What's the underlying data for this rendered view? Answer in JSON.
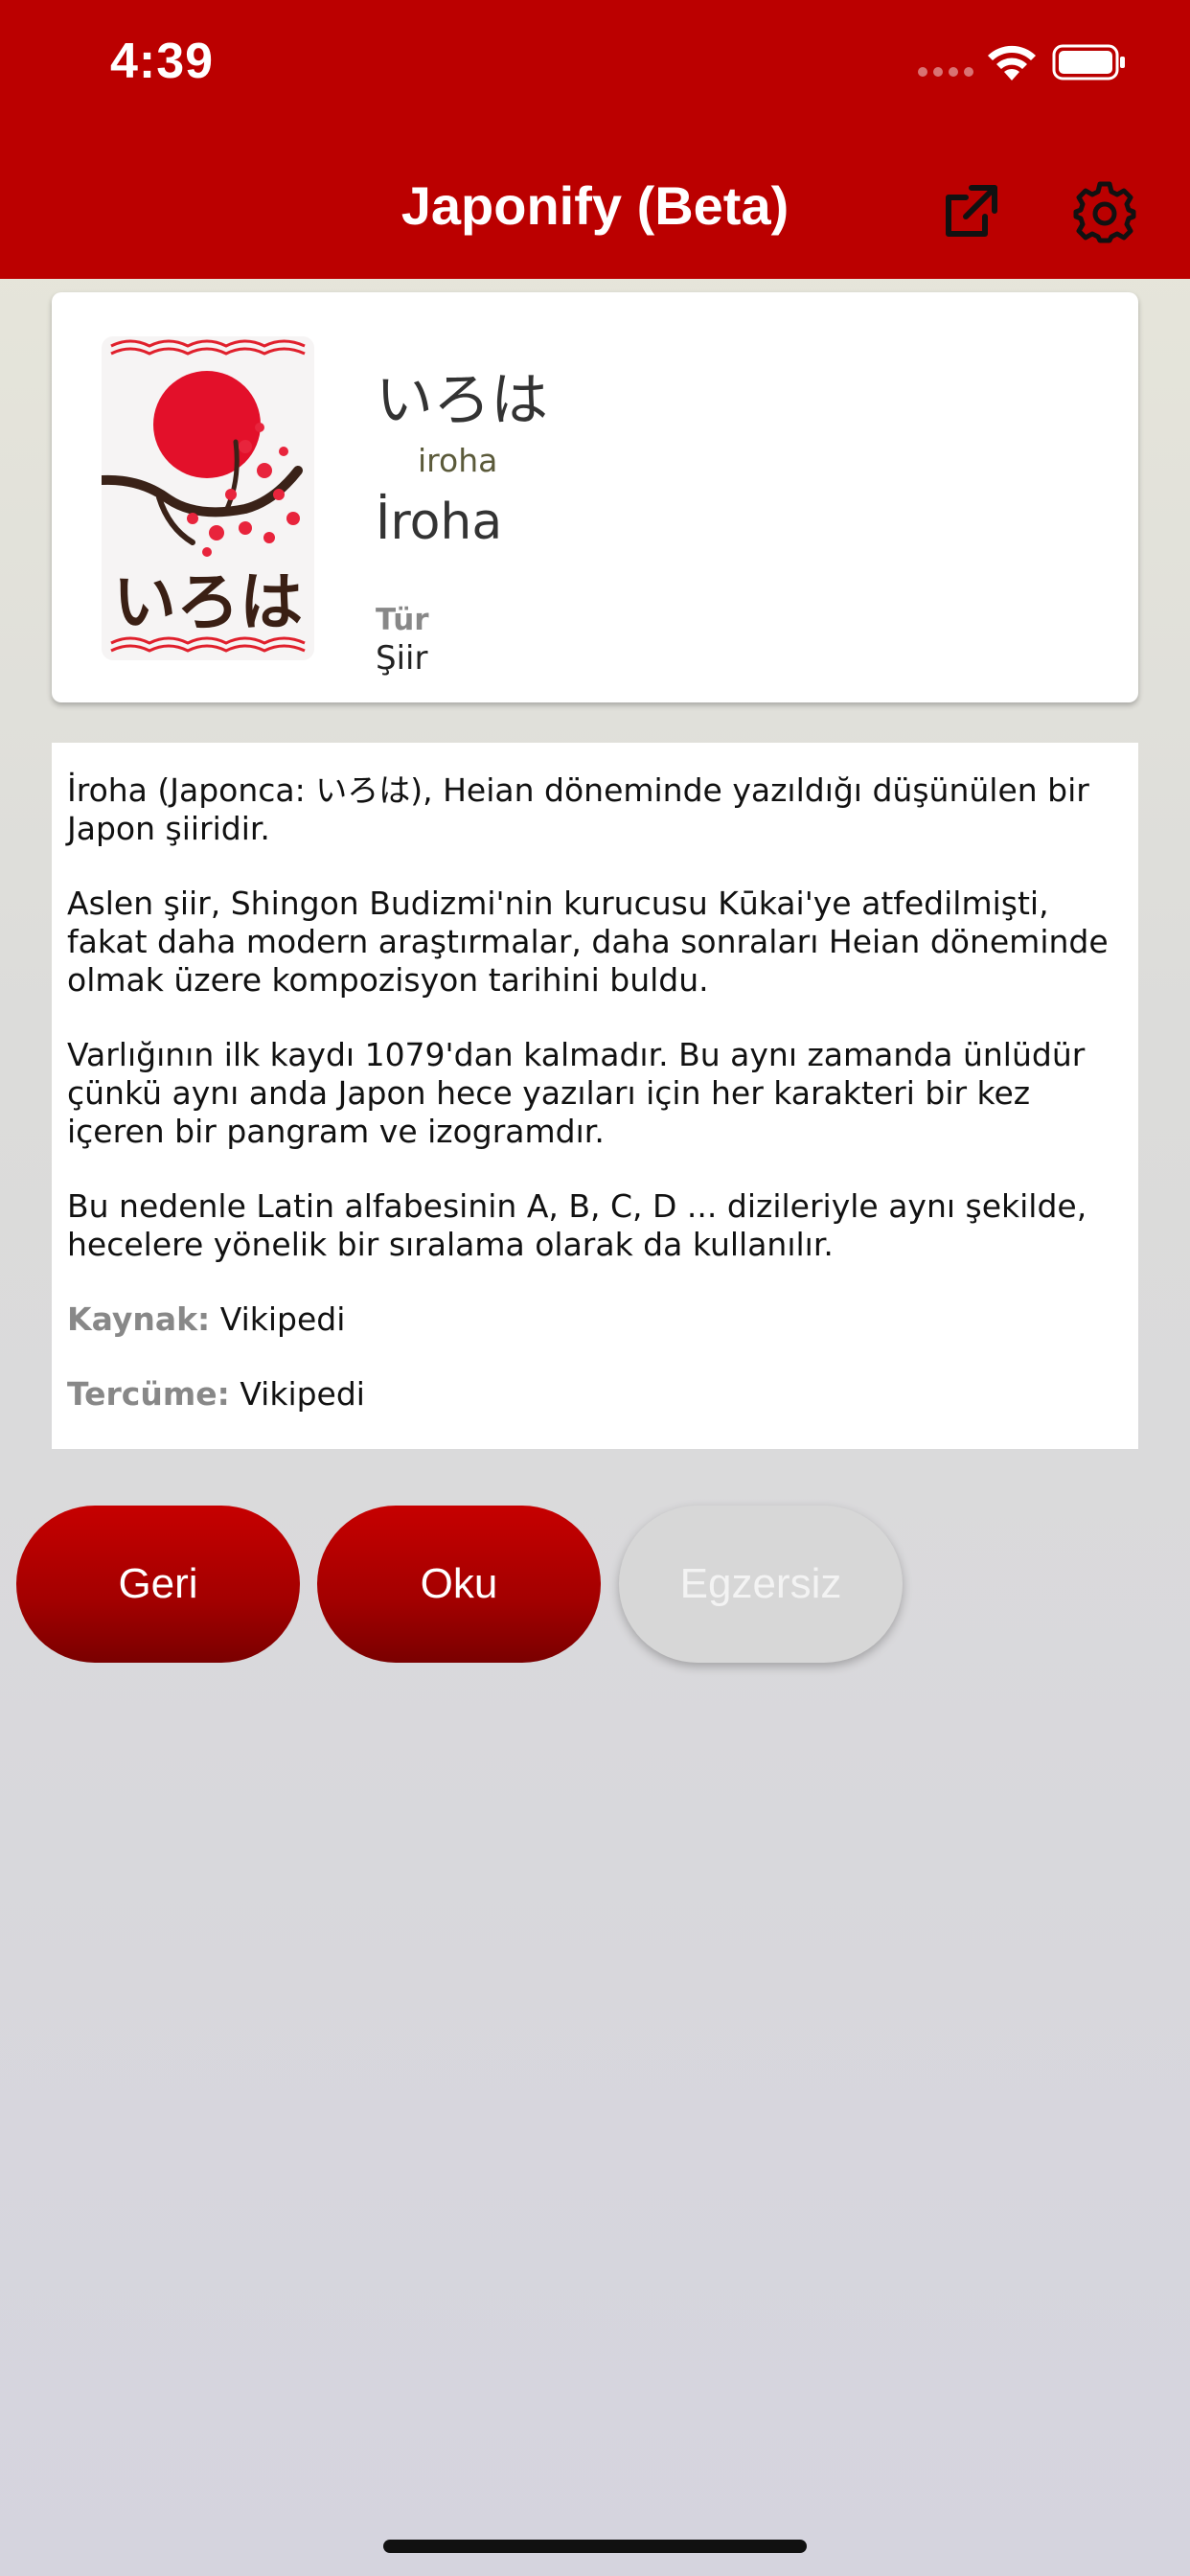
{
  "status_bar": {
    "time": "4:39"
  },
  "header": {
    "title": "Japonify (Beta)",
    "share_icon": "external-link-icon",
    "settings_icon": "gear-icon",
    "color": "#bb0000"
  },
  "info": {
    "japanese_title": "いろは",
    "romaji": "iroha",
    "turkish_title": "İroha",
    "genre_label": "Tür",
    "genre_value": "Şiir",
    "poster_text": "いろは"
  },
  "description": {
    "paragraphs": [
      "İroha (Japonca: いろは), Heian döneminde yazıldığı düşünülen bir Japon şiiridir.",
      "Aslen şiir, Shingon Budizmi'nin kurucusu Kūkai'ye atfedilmişti, fakat daha modern araştırmalar, daha sonraları Heian döneminde olmak üzere kompozisyon tarihini buldu.",
      "Varlığının ilk kaydı 1079'dan kalmadır. Bu aynı zamanda ünlüdür çünkü aynı anda Japon hece yazıları için her karakteri bir kez içeren bir pangram ve izogramdır.",
      "Bu nedenle Latin alfabesinin A, B, C, D ... dizileriyle aynı şekilde, hecelere yönelik bir sıralama olarak da kullanılır."
    ],
    "source_label": "Kaynak:",
    "source_value": "Vikipedi",
    "translation_label": "Tercüme:",
    "translation_value": "Vikipedi"
  },
  "buttons": {
    "back": "Geri",
    "read": "Oku",
    "exercise": "Egzersiz"
  }
}
